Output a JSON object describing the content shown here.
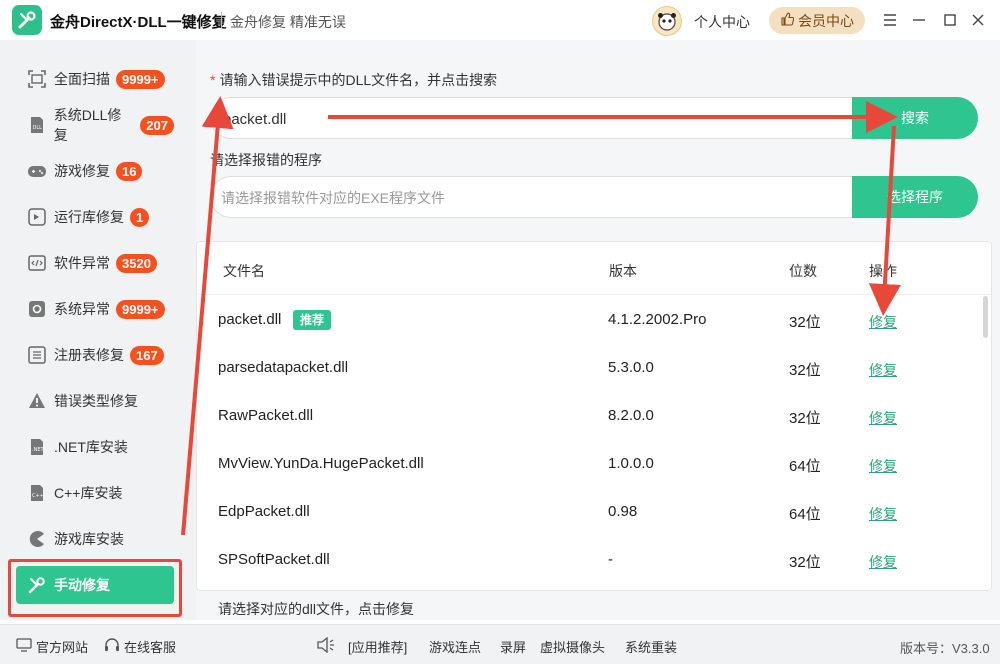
{
  "app": {
    "title": "金舟DirectX·DLL一键修复",
    "slogan": "金舟修复 精准无误",
    "user_center": "个人中心",
    "vip": "会员中心"
  },
  "sidebar": {
    "items": [
      {
        "label": "全面扫描",
        "badge": "9999+"
      },
      {
        "label": "系统DLL修复",
        "badge": "207"
      },
      {
        "label": "游戏修复",
        "badge": "16"
      },
      {
        "label": "运行库修复",
        "badge": "1"
      },
      {
        "label": "软件异常",
        "badge": "3520"
      },
      {
        "label": "系统异常",
        "badge": "9999+"
      },
      {
        "label": "注册表修复",
        "badge": "167"
      },
      {
        "label": "错误类型修复"
      },
      {
        "label": ".NET库安装"
      },
      {
        "label": "C++库安装"
      },
      {
        "label": "游戏库安装"
      },
      {
        "label": "手动修复"
      }
    ]
  },
  "search": {
    "label": "请输入错误提示中的DLL文件名，并点击搜索",
    "value": "packet.dll",
    "button": "搜索"
  },
  "program": {
    "label": "请选择报错的程序",
    "placeholder": "请选择报错软件对应的EXE程序文件",
    "button": "选择程序"
  },
  "table": {
    "headers": [
      "文件名",
      "版本",
      "位数",
      "操作"
    ],
    "rows": [
      {
        "name": "packet.dll",
        "badge": "推荐",
        "version": "4.1.2.2002.Pro",
        "bits": "32位",
        "action": "修复"
      },
      {
        "name": "parsedatapacket.dll",
        "version": "5.3.0.0",
        "bits": "32位",
        "action": "修复"
      },
      {
        "name": "RawPacket.dll",
        "version": "8.2.0.0",
        "bits": "32位",
        "action": "修复"
      },
      {
        "name": "MvView.YunDa.HugePacket.dll",
        "version": "1.0.0.0",
        "bits": "64位",
        "action": "修复"
      },
      {
        "name": "EdpPacket.dll",
        "version": "0.98",
        "bits": "64位",
        "action": "修复"
      },
      {
        "name": "SPSoftPacket.dll",
        "version": "-",
        "bits": "32位",
        "action": "修复"
      }
    ]
  },
  "hint": "请选择对应的dll文件，点击修复",
  "footer": {
    "website": "官方网站",
    "service": "在线客服",
    "links": [
      "[应用推荐]",
      "游戏连点",
      "录屏",
      "虚拟摄像头",
      "系统重装"
    ],
    "version": "版本号：V3.3.0"
  },
  "colors": {
    "accent": "#2fc590",
    "badge": "#f5511e",
    "annotation": "#e8483a"
  }
}
